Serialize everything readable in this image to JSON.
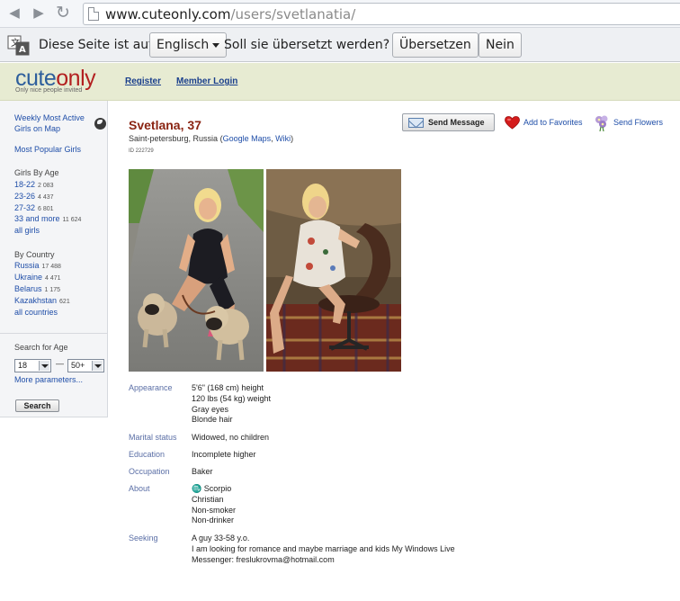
{
  "browser": {
    "url_host": "www.cuteonly.com",
    "url_path": "/users/svetlanatia/"
  },
  "translate_bar": {
    "text_prefix": "Diese Seite ist auf",
    "language": "Englisch",
    "question": "Soll sie übersetzt werden?",
    "translate_button": "Übersetzen",
    "no_button": "Nein"
  },
  "header": {
    "logo_cute": "cute",
    "logo_only": "only",
    "tagline": "Only nice people invited",
    "register": "Register",
    "member_login": "Member Login"
  },
  "sidebar": {
    "weekly_line1": "Weekly Most Active",
    "weekly_line2": "Girls on Map",
    "most_popular": "Most Popular Girls",
    "by_age_heading": "Girls By Age",
    "age_groups": [
      {
        "label": "18-22",
        "count": "2 083"
      },
      {
        "label": "23-26",
        "count": "4 437"
      },
      {
        "label": "27-32",
        "count": "6 801"
      },
      {
        "label": "33 and more",
        "count": "11 624"
      }
    ],
    "all_girls": "all girls",
    "by_country_heading": "By Country",
    "countries": [
      {
        "label": "Russia",
        "count": "17 488"
      },
      {
        "label": "Ukraine",
        "count": "4 471"
      },
      {
        "label": "Belarus",
        "count": "1 175"
      },
      {
        "label": "Kazakhstan",
        "count": "621"
      }
    ],
    "all_countries": "all countries",
    "search_heading": "Search for Age",
    "age_from": "18",
    "age_to": "50+",
    "dash": "—",
    "more_params": "More parameters...",
    "search_button": "Search"
  },
  "profile": {
    "name": "Svetlana, 37",
    "location": "Saint-petersburg, Russia",
    "maps_link": "Google Maps",
    "wiki_link": "Wiki",
    "id_line": "ID 222729",
    "send_message": "Send Message",
    "add_favorites": "Add to Favorites",
    "send_flowers": "Send Flowers",
    "appearance_label": "Appearance",
    "appearance": [
      "5'6\" (168 cm) height",
      "120 lbs (54 kg) weight",
      "Gray eyes",
      "Blonde hair"
    ],
    "marital_label": "Marital status",
    "marital": "Widowed, no children",
    "education_label": "Education",
    "education": "Incomplete higher",
    "occupation_label": "Occupation",
    "occupation": "Baker",
    "about_label": "About",
    "about": [
      "Scorpio",
      "Christian",
      "Non-smoker",
      "Non-drinker"
    ],
    "seeking_label": "Seeking",
    "seeking": [
      "A guy 33-58 y.o.",
      "I am looking for romance and maybe marriage and kids My Windows Live",
      "Messenger: freslukrovma@hotmail.com"
    ]
  },
  "colors": {
    "header_bg": "#e7ebd2",
    "name_color": "#8a2412",
    "link_color": "#1f4ea8",
    "label_color": "#5b6fa6"
  }
}
